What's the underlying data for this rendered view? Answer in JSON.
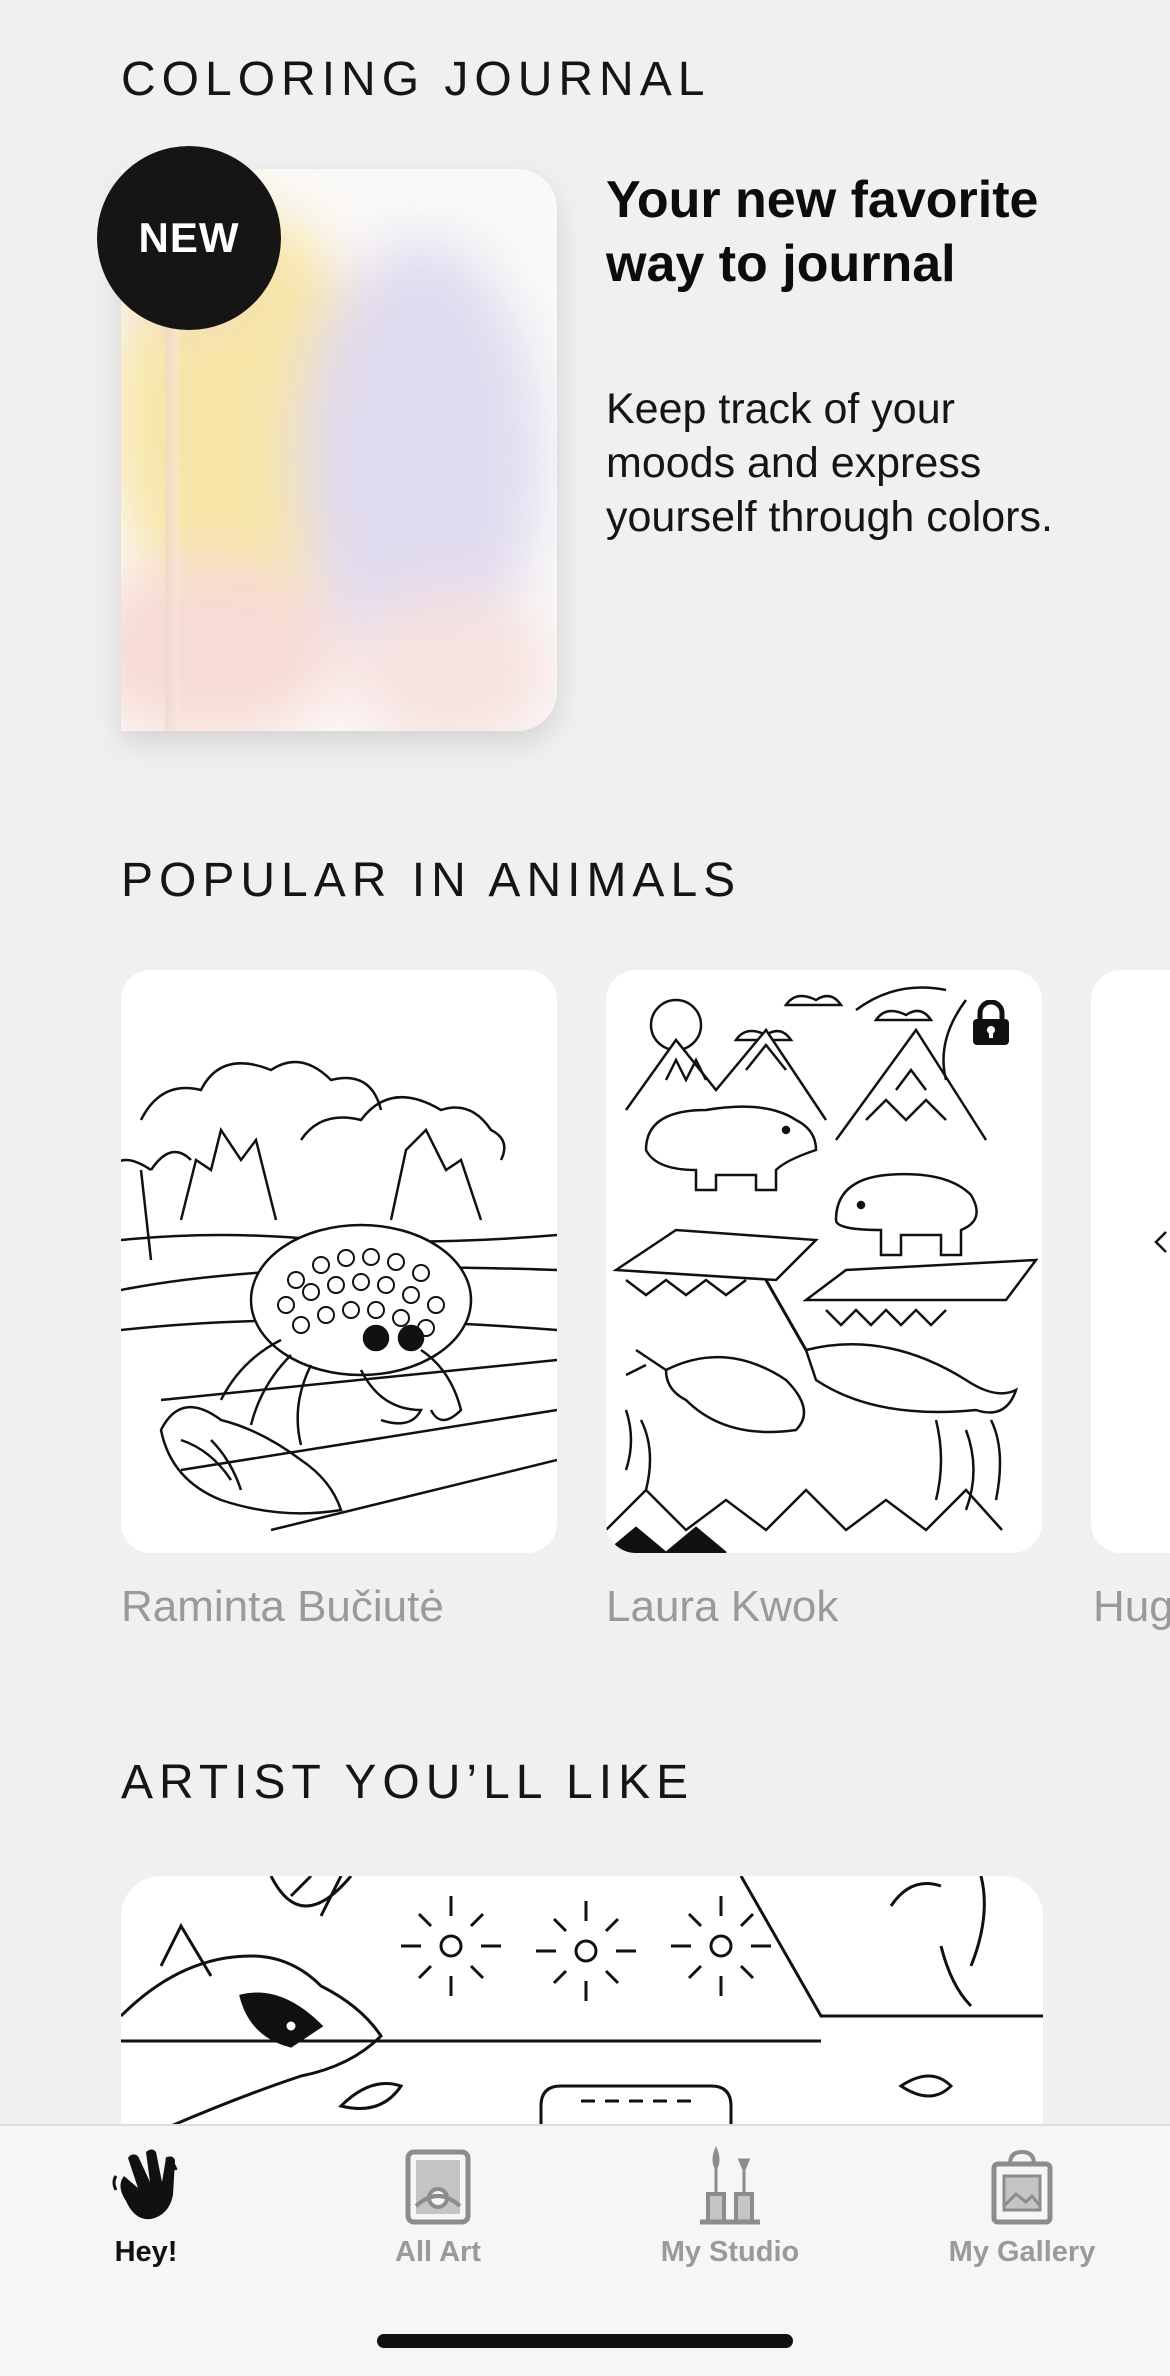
{
  "sections": {
    "journal_title": "COLORING JOURNAL",
    "animals_title": "POPULAR IN ANIMALS",
    "artist_title": "ARTIST YOU’LL LIKE"
  },
  "journal": {
    "badge": "NEW",
    "heading": "Your new favorite way to journal",
    "description": "Keep track of your moods and express yourself through colors."
  },
  "animals": {
    "items": [
      {
        "artist": "Raminta Bučiutė",
        "locked": false
      },
      {
        "artist": "Laura Kwok",
        "locked": true
      },
      {
        "artist": "Hug",
        "locked": false
      }
    ]
  },
  "tabbar": {
    "tabs": [
      {
        "label": "Hey!",
        "icon": "hand-wave-icon",
        "active": true
      },
      {
        "label": "All Art",
        "icon": "picture-frame-icon",
        "active": false
      },
      {
        "label": "My Studio",
        "icon": "brushes-icon",
        "active": false
      },
      {
        "label": "My Gallery",
        "icon": "gallery-bag-icon",
        "active": false
      }
    ]
  },
  "colors": {
    "background": "#f0f0f0",
    "badge": "#151515",
    "muted_text": "#9a9a9a",
    "active_tab": "#111111"
  }
}
